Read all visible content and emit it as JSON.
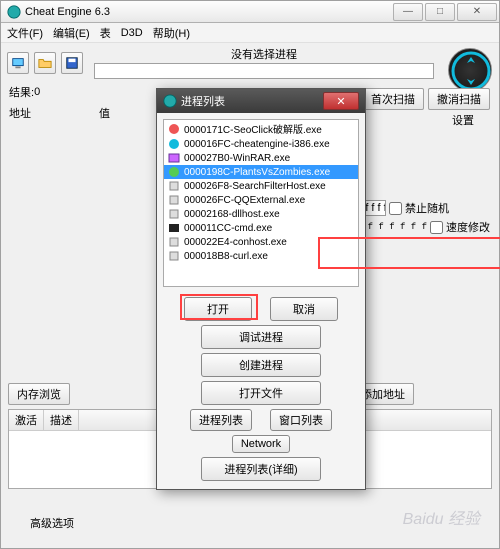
{
  "window": {
    "title": "Cheat Engine 6.3"
  },
  "menu": {
    "file": "文件(F)",
    "edit": "编辑(E)",
    "table": "表",
    "d3d": "D3D",
    "help": "帮助(H)"
  },
  "toolbar": {
    "no_process": "没有选择进程"
  },
  "results": {
    "label": "结果:",
    "count": "0"
  },
  "headers": {
    "address": "地址",
    "value": "值"
  },
  "right_buttons": {
    "first_scan": "首次扫描",
    "undo_scan": "撤消扫描",
    "settings": "设置"
  },
  "checkboxes": {
    "prevent_random": "禁止随机",
    "speed_hack": "速度修改"
  },
  "hex_text": "f f f f f f f f",
  "bottom": {
    "mem_view": "内存浏览",
    "manual_add": "手动添加地址",
    "active": "激活",
    "desc": "描述",
    "advanced": "高级选项"
  },
  "dialog": {
    "title": "进程列表",
    "processes": [
      "0000171C-SeoClick破解版.exe",
      "000016FC-cheatengine-i386.exe",
      "000027B0-WinRAR.exe",
      "0000198C-PlantsVsZombies.exe",
      "000026F8-SearchFilterHost.exe",
      "000026FC-QQExternal.exe",
      "00002168-dllhost.exe",
      "000011CC-cmd.exe",
      "000022E4-conhost.exe",
      "000018B8-curl.exe"
    ],
    "buttons": {
      "open": "打开",
      "cancel": "取消",
      "debug": "调试进程",
      "create": "创建进程",
      "open_file": "打开文件",
      "proc_list": "进程列表",
      "win_list": "窗口列表",
      "network": "Network",
      "detail": "进程列表(详细)"
    }
  },
  "watermark": "Baidu 经验"
}
